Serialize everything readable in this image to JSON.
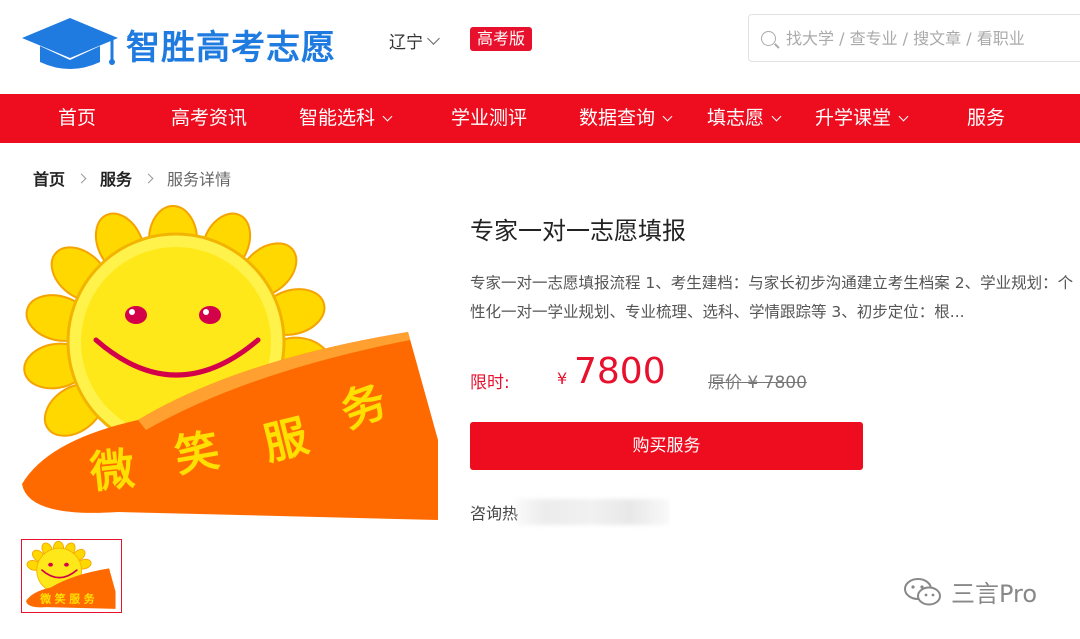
{
  "header": {
    "logo_text": "智胜高考志愿",
    "province": "辽宁",
    "edition_badge": "高考版",
    "search_placeholder": "找大学 / 查专业 / 搜文章 / 看职业"
  },
  "nav": {
    "items": [
      {
        "label": "首页",
        "dropdown": false
      },
      {
        "label": "高考资讯",
        "dropdown": false
      },
      {
        "label": "智能选科",
        "dropdown": true
      },
      {
        "label": "学业测评",
        "dropdown": false
      },
      {
        "label": "数据查询",
        "dropdown": true
      },
      {
        "label": "填志愿",
        "dropdown": true
      },
      {
        "label": "升学课堂",
        "dropdown": true
      },
      {
        "label": "服务",
        "dropdown": false
      }
    ]
  },
  "breadcrumb": [
    "首页",
    "服务",
    "服务详情"
  ],
  "product": {
    "image_text": "微笑服务",
    "thumb_text": "微笑服务",
    "title": "专家一对一志愿填报",
    "description": "专家一对一志愿填报流程 1、考生建档：与家长初步沟通建立考生档案 2、学业规划：个性化一对一学业规划、专业梳理、选科、学情跟踪等 3、初步定位：根...",
    "price_label": "限时:",
    "currency": "¥",
    "price": "7800",
    "original_price": "原价 ¥ 7800",
    "buy_button": "购买服务",
    "hotline_label": "咨询热"
  },
  "watermark": {
    "text": "三言Pro",
    "icon": "wechat-icon"
  },
  "colors": {
    "brand_red": "#ee0c1f",
    "logo_blue": "#1f7be0",
    "sun_yellow": "#ffe01a",
    "banner_orange": "#ff6a00"
  }
}
